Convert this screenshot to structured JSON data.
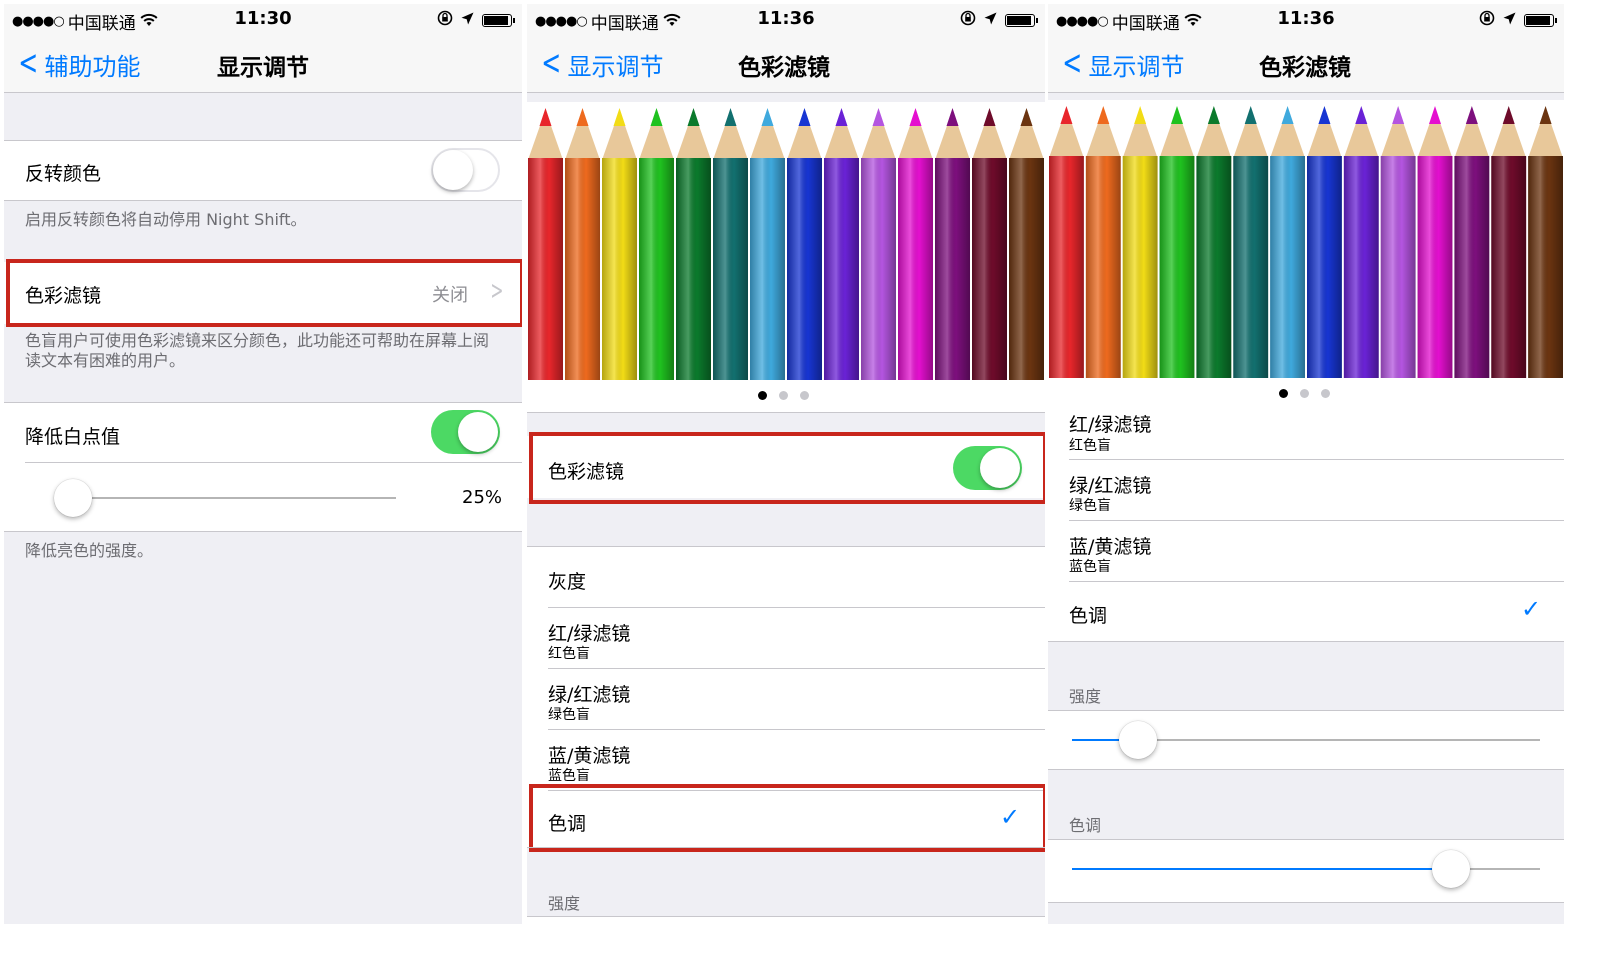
{
  "screens": [
    {
      "status": {
        "carrier": "中国联通",
        "time": "11:30"
      },
      "nav": {
        "back": "辅助功能",
        "title": "显示调节"
      },
      "invert": {
        "label": "反转颜色",
        "on": false,
        "footer": "启用反转颜色将自动停用 Night Shift。"
      },
      "color_filters": {
        "label": "色彩滤镜",
        "value": "关闭",
        "footer": "色盲用户可使用色彩滤镜来区分颜色，此功能还可帮助在屏幕上阅读文本有困难的用户。"
      },
      "white_point": {
        "label": "降低白点值",
        "on": true,
        "percent": "25%",
        "level": 0.05,
        "footer": "降低亮色的强度。"
      }
    },
    {
      "status": {
        "carrier": "中国联通",
        "time": "11:36"
      },
      "nav": {
        "back": "显示调节",
        "title": "色彩滤镜"
      },
      "filters_toggle": {
        "label": "色彩滤镜",
        "on": true
      },
      "options": [
        {
          "title": "灰度",
          "sub": ""
        },
        {
          "title": "红/绿滤镜",
          "sub": "红色盲"
        },
        {
          "title": "绿/红滤镜",
          "sub": "绿色盲"
        },
        {
          "title": "蓝/黄滤镜",
          "sub": "蓝色盲"
        },
        {
          "title": "色调",
          "sub": "",
          "checked": true
        }
      ],
      "intensity_header": "强度"
    },
    {
      "status": {
        "carrier": "中国联通",
        "time": "11:36"
      },
      "nav": {
        "back": "显示调节",
        "title": "色彩滤镜"
      },
      "options": [
        {
          "title": "红/绿滤镜",
          "sub": "红色盲"
        },
        {
          "title": "绿/红滤镜",
          "sub": "绿色盲"
        },
        {
          "title": "蓝/黄滤镜",
          "sub": "蓝色盲"
        },
        {
          "title": "色调",
          "sub": "",
          "checked": true
        }
      ],
      "intensity": {
        "header": "强度",
        "level": 0.14
      },
      "hue": {
        "header": "色调",
        "level": 0.81
      }
    }
  ],
  "pencil_colors": [
    "#e8262b",
    "#ee6a1e",
    "#f2dc16",
    "#1fc21f",
    "#0b7a2c",
    "#12706f",
    "#3fa9dd",
    "#1735d2",
    "#6a22d6",
    "#b455e0",
    "#e40fcf",
    "#7d0f7d",
    "#6e0b2a",
    "#6b3410"
  ],
  "page_dots": {
    "count": 3,
    "active": 0
  }
}
